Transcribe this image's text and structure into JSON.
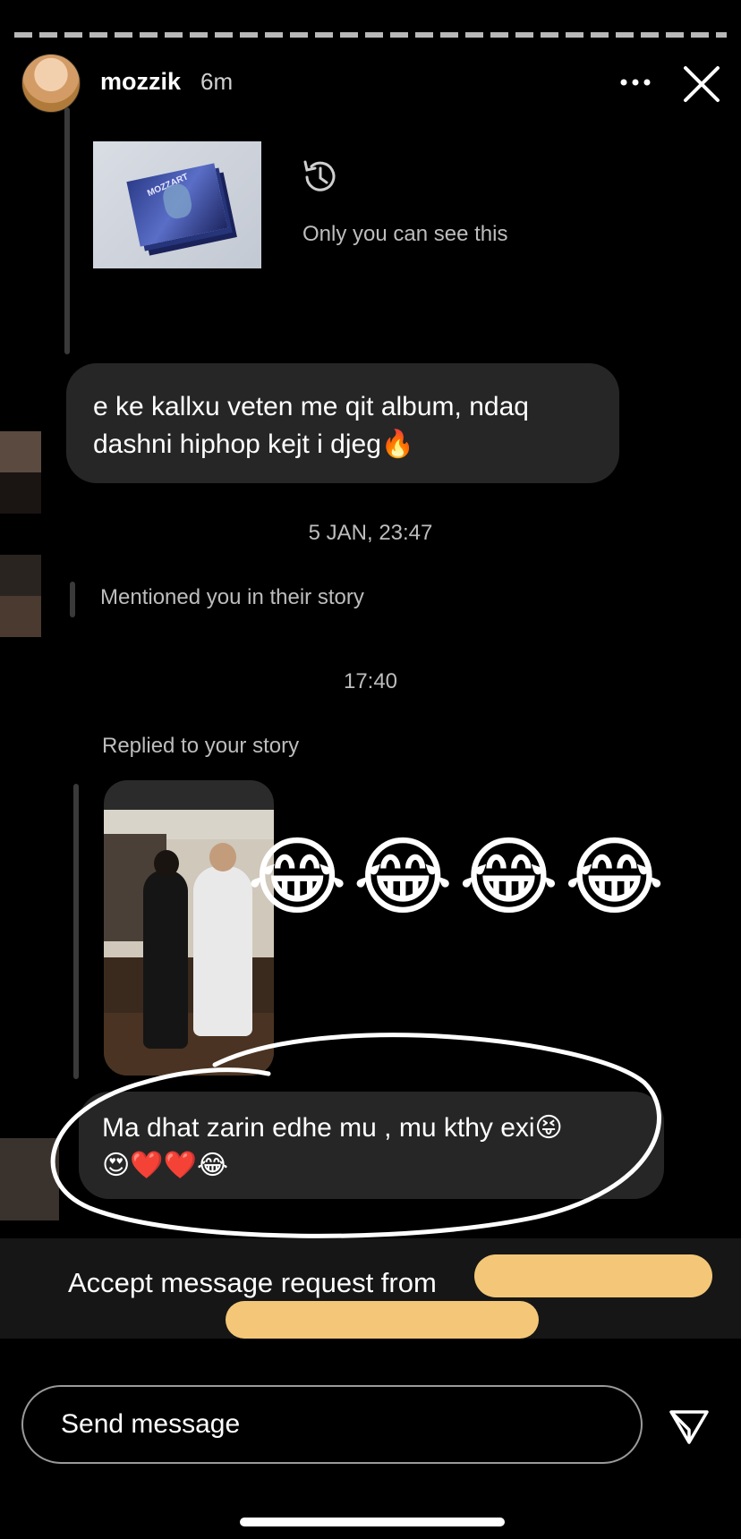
{
  "header": {
    "username": "mozzik",
    "time_ago": "6m"
  },
  "album_note": {
    "album_label": "MOZZART",
    "only_you_text": "Only you can see this"
  },
  "messages": {
    "first_bubble": "e ke kallxu veten me qit album, ndaq dashni hiphop kejt i djeg🔥",
    "timestamp_1": "5 JAN, 23:47",
    "mention_note": "Mentioned you in their story",
    "timestamp_2": "17:40",
    "reply_note": "Replied to your story",
    "reply_emojis": "😂😂😂😂",
    "second_bubble_line1": "Ma dhat zarin edhe mu , mu kthy exi😝",
    "second_bubble_line2": "😍❤️❤️😂"
  },
  "accept_bar": {
    "text": "Accept message request from"
  },
  "composer": {
    "placeholder": "Send message"
  },
  "colors": {
    "background": "#000000",
    "bubble": "#262626",
    "redaction": "#f3c777",
    "secondary_text": "#bdbdbd"
  },
  "icons": {
    "more": "more-horizontal-icon",
    "close": "close-icon",
    "history": "history-icon",
    "send": "send-paper-plane-icon"
  }
}
